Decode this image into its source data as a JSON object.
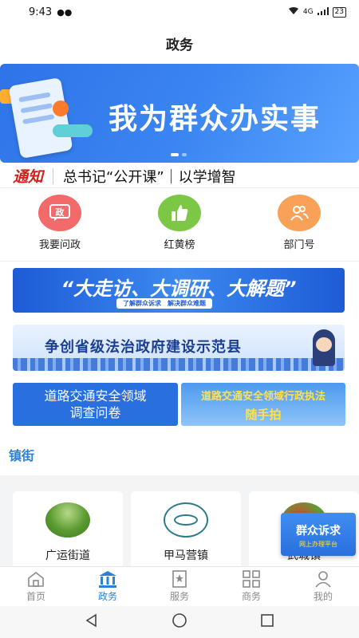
{
  "status_bar": {
    "time": "9:43",
    "network": "4G",
    "battery": "23"
  },
  "header": {
    "title": "政务"
  },
  "banner": {
    "headline": "我为群众办实事"
  },
  "notice": {
    "tag": "通知",
    "text": "总书记“公开课”｜以学增智"
  },
  "quick_actions": [
    {
      "label": "我要问政",
      "icon": "message-icon",
      "glyph": "政",
      "color": "#f26a6a"
    },
    {
      "label": "红黄榜",
      "icon": "thumbs-up-icon",
      "glyph": "👍",
      "color": "#7cc846"
    },
    {
      "label": "部门号",
      "icon": "people-icon",
      "glyph": "👥",
      "color": "#f7a258"
    }
  ],
  "promos": {
    "p1_main": "“大走访、大调研、大解题”",
    "p1_sub": "了解群众诉求　解决群众难题",
    "p2_text": "争创省级法治政府建设示范县",
    "p3_line1": "道路交通安全领域",
    "p3_line2": "调查问卷",
    "p4_top": "道路交通安全领域行政执法",
    "p4_bottom": "随手拍"
  },
  "section": {
    "title": "镇街"
  },
  "towns": [
    {
      "label": "广运街道"
    },
    {
      "label": "甲马营镇"
    },
    {
      "label": "武城镇"
    }
  ],
  "floating": {
    "main": "群众诉求",
    "sub": "网上办理平台"
  },
  "tabbar": [
    {
      "label": "首页",
      "icon": "home-icon",
      "active": false
    },
    {
      "label": "政务",
      "icon": "government-icon",
      "active": true
    },
    {
      "label": "服务",
      "icon": "service-icon",
      "active": false
    },
    {
      "label": "商务",
      "icon": "business-icon",
      "active": false
    },
    {
      "label": "我的",
      "icon": "user-icon",
      "active": false
    }
  ],
  "colors": {
    "accent": "#2a82d6",
    "banner": "#3b86f2",
    "notice_red": "#d0221d"
  }
}
